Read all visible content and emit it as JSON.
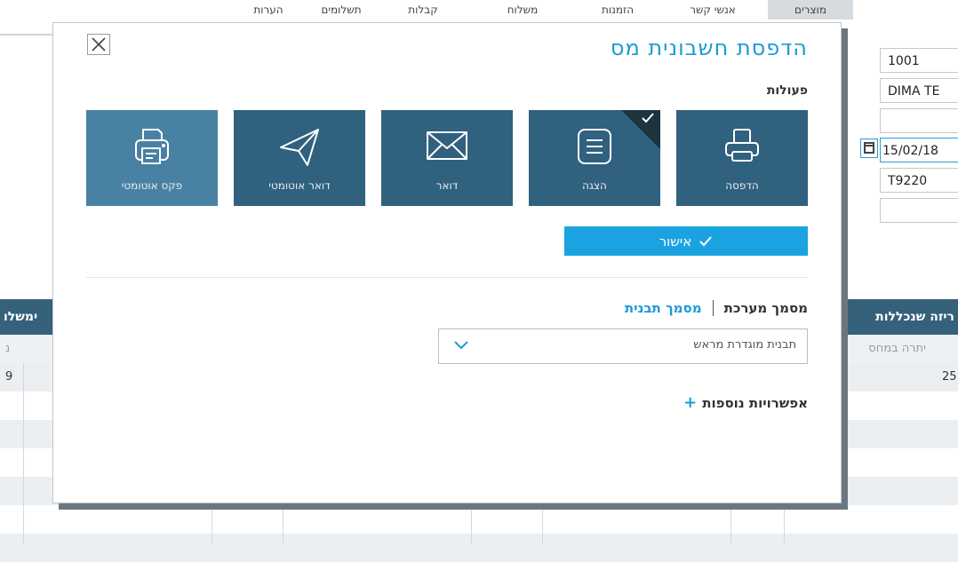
{
  "background": {
    "tabs": [
      "מוצרים",
      "אנשי קשר",
      "הזמנות",
      "משלוח",
      "קבלות",
      "תשלומים",
      "הערות"
    ],
    "fields": [
      "1001",
      "DIMA TE",
      "",
      "15/02/18",
      "T9220",
      ""
    ],
    "header_right": "ריזה שנכללות",
    "header_left": "ימשלו",
    "subheader_right": "יתרה במחס",
    "subheader_left": "נ",
    "row_value_right": "25",
    "row_value_left": "9"
  },
  "modal": {
    "title": "הדפסת חשבונית מס",
    "actions_label": "פעולות",
    "tiles": [
      {
        "label": "הדפסה",
        "icon": "printer-icon",
        "checked": false
      },
      {
        "label": "הצגה",
        "icon": "display-icon",
        "checked": true
      },
      {
        "label": "דואר",
        "icon": "envelope-icon",
        "checked": false
      },
      {
        "label": "דואר אוטומטי",
        "icon": "paper-plane-icon",
        "checked": false
      },
      {
        "label": "פקס אוטומטי",
        "icon": "fax-icon",
        "checked": false
      }
    ],
    "approve_label": "אישור",
    "system_doc_link": "מסמך מערכת",
    "template_doc_link": "מסמך תבנית",
    "template_select_value": "תבנית מוגדרת מראש",
    "more_options_label": "אפשרויות נוספות",
    "colors": {
      "accent": "#1b9ad6",
      "tile": "#30617e",
      "tile_light": "#4981a2"
    }
  }
}
